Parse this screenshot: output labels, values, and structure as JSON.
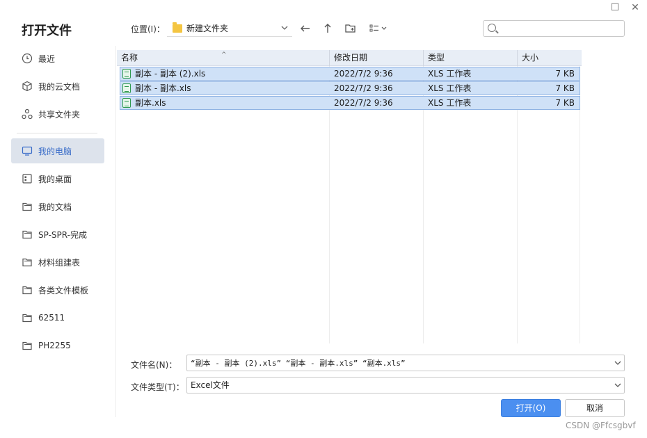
{
  "window": {
    "title": "打开文件"
  },
  "sidebar": {
    "items": [
      {
        "label": "最近",
        "icon": "clock-icon"
      },
      {
        "label": "我的云文档",
        "icon": "cloud-cube-icon"
      },
      {
        "label": "共享文件夹",
        "icon": "share-icon"
      },
      {
        "label": "我的电脑",
        "icon": "monitor-icon",
        "active": true
      },
      {
        "label": "我的桌面",
        "icon": "desktop-grid-icon"
      },
      {
        "label": "我的文档",
        "icon": "folder-icon"
      },
      {
        "label": "SP-SPR-完成",
        "icon": "folder-icon"
      },
      {
        "label": "材料组建表",
        "icon": "folder-icon"
      },
      {
        "label": "各类文件模板",
        "icon": "folder-icon"
      },
      {
        "label": "62511",
        "icon": "folder-icon"
      },
      {
        "label": "PH2255",
        "icon": "folder-icon"
      }
    ]
  },
  "toolbar": {
    "location_label": "位置(I)：",
    "location_value": "新建文件夹",
    "search_placeholder": ""
  },
  "file_list": {
    "columns": [
      "名称",
      "修改日期",
      "类型",
      "大小"
    ],
    "rows": [
      {
        "name": "副本 - 副本 (2).xls",
        "date": "2022/7/2 9:36",
        "type": "XLS 工作表",
        "size": "7 KB"
      },
      {
        "name": "副本 - 副本.xls",
        "date": "2022/7/2 9:36",
        "type": "XLS 工作表",
        "size": "7 KB"
      },
      {
        "name": "副本.xls",
        "date": "2022/7/2 9:36",
        "type": "XLS 工作表",
        "size": "7 KB"
      }
    ]
  },
  "form": {
    "filename_label": "文件名(N)：",
    "filename_value": "“副本 - 副本 (2).xls” “副本 - 副本.xls” “副本.xls”",
    "filetype_label": "文件类型(T)：",
    "filetype_value": "Excel文件"
  },
  "buttons": {
    "open": "打开(O)",
    "cancel": "取消"
  },
  "watermark": "CSDN @Ffcsgbvf",
  "colors": {
    "accent": "#4b8ff0",
    "selection": "#cfe1f7",
    "active_nav": "#3a6dc9"
  }
}
